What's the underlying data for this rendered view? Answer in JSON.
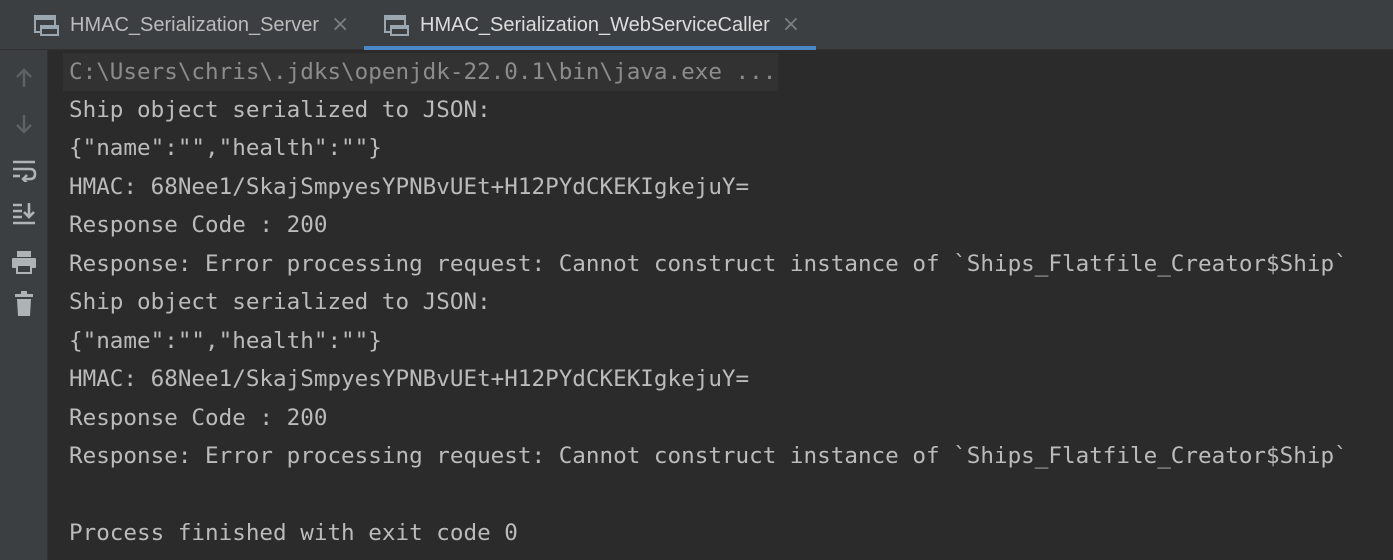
{
  "tabs": [
    {
      "label": "HMAC_Serialization_Server",
      "active": false
    },
    {
      "label": "HMAC_Serialization_WebServiceCaller",
      "active": true
    }
  ],
  "colors": {
    "background": "#2b2b2b",
    "panel": "#3c3f41",
    "text": "#bbbbbb",
    "muted_text": "#8c8c8c",
    "accent": "#4a88c7"
  },
  "toolbar": [
    "up-arrow-icon",
    "down-arrow-icon",
    "soft-wrap-icon",
    "scroll-to-end-icon",
    "print-icon",
    "clear-all-icon"
  ],
  "console": {
    "command": "C:\\Users\\chris\\.jdks\\openjdk-22.0.1\\bin\\java.exe ...",
    "lines": [
      "Ship object serialized to JSON:",
      "{\"name\":\"\",\"health\":\"\"}",
      "HMAC: 68Nee1/SkajSmpyesYPNBvUEt+H12PYdCKEKIgkejuY=",
      "Response Code : 200",
      "Response: Error processing request: Cannot construct instance of `Ships_Flatfile_Creator$Ship`",
      "Ship object serialized to JSON:",
      "{\"name\":\"\",\"health\":\"\"}",
      "HMAC: 68Nee1/SkajSmpyesYPNBvUEt+H12PYdCKEKIgkejuY=",
      "Response Code : 200",
      "Response: Error processing request: Cannot construct instance of `Ships_Flatfile_Creator$Ship`",
      "",
      "Process finished with exit code 0"
    ]
  }
}
